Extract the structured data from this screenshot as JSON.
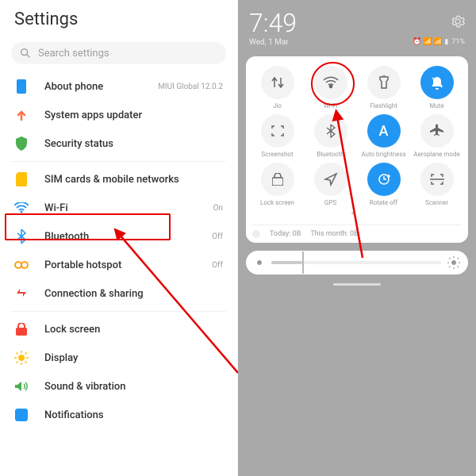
{
  "left": {
    "title": "Settings",
    "search_placeholder": "Search settings",
    "about": {
      "label": "About phone",
      "value": "MIUI Global 12.0.2"
    },
    "updater": {
      "label": "System apps updater"
    },
    "security": {
      "label": "Security status"
    },
    "sim": {
      "label": "SIM cards & mobile networks"
    },
    "wifi": {
      "label": "Wi-Fi",
      "value": "On"
    },
    "bt": {
      "label": "Bluetooth",
      "value": "Off"
    },
    "hotspot": {
      "label": "Portable hotspot",
      "value": "Off"
    },
    "connection": {
      "label": "Connection & sharing"
    },
    "lock": {
      "label": "Lock screen"
    },
    "display": {
      "label": "Display"
    },
    "sound": {
      "label": "Sound & vibration"
    },
    "notif": {
      "label": "Notifications"
    }
  },
  "right": {
    "time": "7:49",
    "date": "Wed, 1 Mar",
    "battery": "71%",
    "toggles": {
      "jio": "Jio",
      "wifi": "Wi-Fi",
      "flash": "Flashlight",
      "mute": "Mute",
      "screenshot": "Screenshot",
      "bt": "Bluetooth",
      "autobright": "Auto brightness",
      "airplane": "Aeroplane mode",
      "lock": "Lock screen",
      "gps": "GPS",
      "rotate": "Rotate off",
      "scanner": "Scanner"
    },
    "data_today": "Today: 0B",
    "data_month": "This month: 0B"
  }
}
